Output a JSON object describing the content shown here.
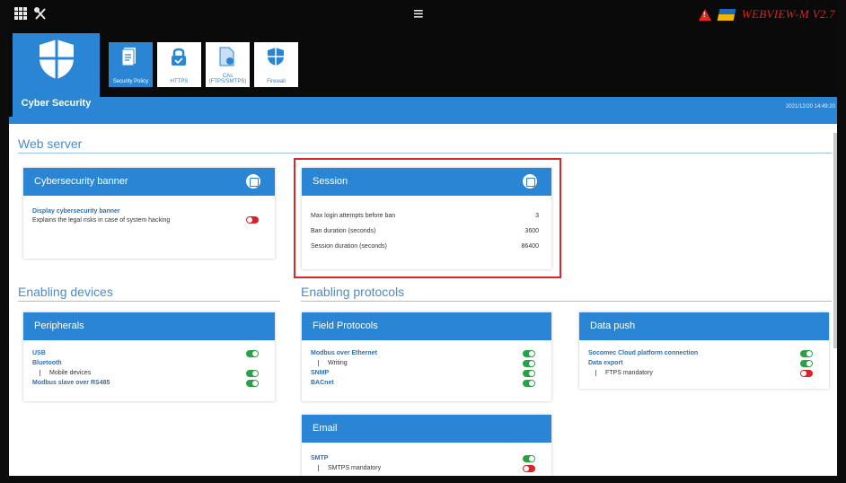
{
  "header": {
    "brand": "WEBVIEW-M V2.7",
    "app_title": "Cyber Security",
    "datetime": "2021/12/20 14:49:20",
    "icons": [
      "grid-icon",
      "tools-icon",
      "menu-icon",
      "alarm-icon",
      "flag-icon"
    ]
  },
  "tabs": [
    {
      "label": "Security Policy",
      "icon": "document-check-icon",
      "active": true
    },
    {
      "label": "HTTPS",
      "icon": "lock-icon",
      "active": false
    },
    {
      "label": "CAs (FTPS/SMTPS)",
      "icon": "certificate-icon",
      "active": false
    },
    {
      "label": "Firewall",
      "icon": "shield-icon",
      "active": false
    }
  ],
  "sections": {
    "web_server": "Web server",
    "enabling_devices": "Enabling devices",
    "enabling_protocols": "Enabling protocols"
  },
  "banner_card": {
    "title": "Cybersecurity banner",
    "item_label": "Display cybersecurity banner",
    "item_desc": "Explains the legal risks in case of system hacking",
    "enabled": false
  },
  "session_card": {
    "title": "Session",
    "rows": [
      {
        "label": "Max login attempts before ban",
        "value": "3"
      },
      {
        "label": "Ban duration (seconds)",
        "value": "3600"
      },
      {
        "label": "Session duration (seconds)",
        "value": "86400"
      }
    ]
  },
  "peripherals_card": {
    "title": "Peripherals",
    "usb": "USB",
    "bluetooth": "Bluetooth",
    "mobile_devices": "Mobile devices",
    "modbus_slave": "Modbus slave over RS485"
  },
  "field_protocols_card": {
    "title": "Field Protocols",
    "modbus_eth": "Modbus over Ethernet",
    "writing": "Writing",
    "snmp": "SNMP",
    "bacnet": "BACnet"
  },
  "data_push_card": {
    "title": "Data push",
    "cloud": "Socomec Cloud platform connection",
    "export": "Data export",
    "ftps": "FTPS mandatory"
  },
  "email_card": {
    "title": "Email",
    "smtp": "SMTP",
    "smtps": "SMTPS mandatory"
  },
  "colors": {
    "primary_blue": "#2a86d4",
    "toggle_on": "#2aa147",
    "toggle_off": "#d8232a",
    "highlight": "#d6262a",
    "brand_red": "#d4241f"
  }
}
